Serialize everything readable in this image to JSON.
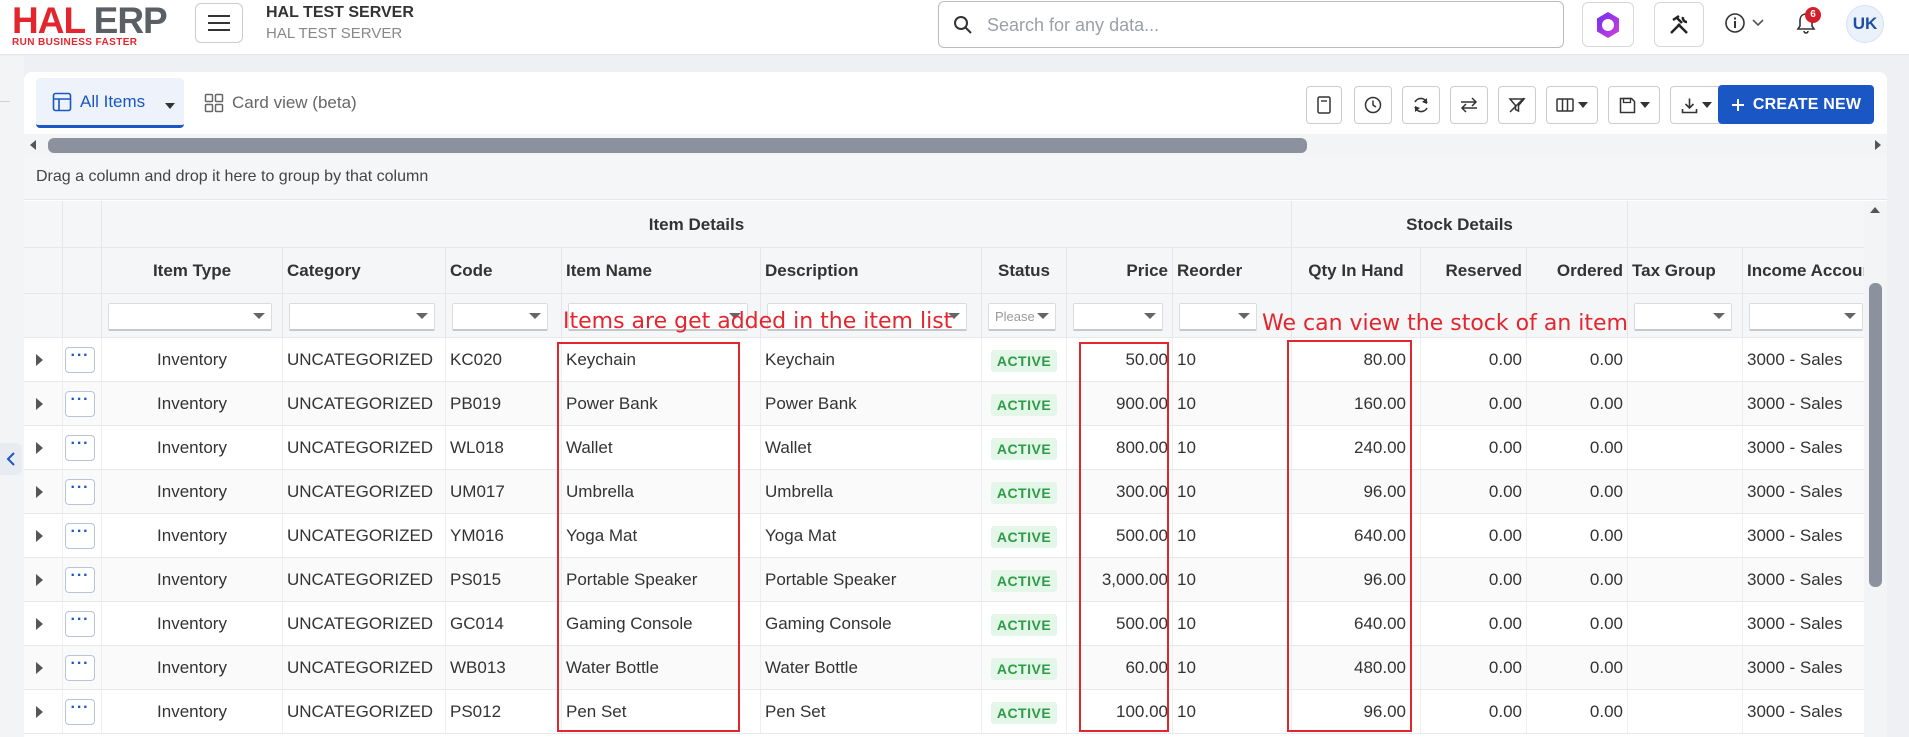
{
  "app": {
    "logo_text_1": "HAL",
    "logo_text_2": "ERP",
    "logo_tagline": "RUN BUSINESS FASTER",
    "server_title": "HAL TEST SERVER",
    "server_subtitle": "HAL TEST SERVER",
    "search_placeholder": "Search for any data...",
    "notification_count": "6",
    "avatar_initials": "UK"
  },
  "tabs": {
    "all_items": "All Items",
    "card_view": "Card view (beta)"
  },
  "toolbar": {
    "create_label": "CREATE NEW"
  },
  "group_hint": "Drag a column and drop it here to group by that column",
  "column_groups": {
    "item_details": "Item Details",
    "stock_details": "Stock Details"
  },
  "columns": {
    "item_type": "Item Type",
    "category": "Category",
    "code": "Code",
    "item_name": "Item Name",
    "description": "Description",
    "status": "Status",
    "price": "Price",
    "reorder": "Reorder",
    "qty_in_hand": "Qty In Hand",
    "reserved": "Reserved",
    "ordered": "Ordered",
    "tax_group": "Tax Group",
    "income_account": "Income Account"
  },
  "status_filter_placeholder": "Please",
  "rows": [
    {
      "type": "Inventory",
      "category": "UNCATEGORIZED",
      "code": "KC020",
      "name": "Keychain",
      "description": "Keychain",
      "status": "ACTIVE",
      "price": "50.00",
      "reorder": "10",
      "qty": "80.00",
      "reserved": "0.00",
      "ordered": "0.00",
      "tax": "",
      "income": "3000 - Sales"
    },
    {
      "type": "Inventory",
      "category": "UNCATEGORIZED",
      "code": "PB019",
      "name": "Power Bank",
      "description": "Power Bank",
      "status": "ACTIVE",
      "price": "900.00",
      "reorder": "10",
      "qty": "160.00",
      "reserved": "0.00",
      "ordered": "0.00",
      "tax": "",
      "income": "3000 - Sales"
    },
    {
      "type": "Inventory",
      "category": "UNCATEGORIZED",
      "code": "WL018",
      "name": "Wallet",
      "description": "Wallet",
      "status": "ACTIVE",
      "price": "800.00",
      "reorder": "10",
      "qty": "240.00",
      "reserved": "0.00",
      "ordered": "0.00",
      "tax": "",
      "income": "3000 - Sales"
    },
    {
      "type": "Inventory",
      "category": "UNCATEGORIZED",
      "code": "UM017",
      "name": "Umbrella",
      "description": "Umbrella",
      "status": "ACTIVE",
      "price": "300.00",
      "reorder": "10",
      "qty": "96.00",
      "reserved": "0.00",
      "ordered": "0.00",
      "tax": "",
      "income": "3000 - Sales"
    },
    {
      "type": "Inventory",
      "category": "UNCATEGORIZED",
      "code": "YM016",
      "name": "Yoga Mat",
      "description": "Yoga Mat",
      "status": "ACTIVE",
      "price": "500.00",
      "reorder": "10",
      "qty": "640.00",
      "reserved": "0.00",
      "ordered": "0.00",
      "tax": "",
      "income": "3000 - Sales"
    },
    {
      "type": "Inventory",
      "category": "UNCATEGORIZED",
      "code": "PS015",
      "name": "Portable Speaker",
      "description": "Portable Speaker",
      "status": "ACTIVE",
      "price": "3,000.00",
      "reorder": "10",
      "qty": "96.00",
      "reserved": "0.00",
      "ordered": "0.00",
      "tax": "",
      "income": "3000 - Sales"
    },
    {
      "type": "Inventory",
      "category": "UNCATEGORIZED",
      "code": "GC014",
      "name": "Gaming Console",
      "description": "Gaming Console",
      "status": "ACTIVE",
      "price": "500.00",
      "reorder": "10",
      "qty": "640.00",
      "reserved": "0.00",
      "ordered": "0.00",
      "tax": "",
      "income": "3000 - Sales"
    },
    {
      "type": "Inventory",
      "category": "UNCATEGORIZED",
      "code": "WB013",
      "name": "Water Bottle",
      "description": "Water Bottle",
      "status": "ACTIVE",
      "price": "60.00",
      "reorder": "10",
      "qty": "480.00",
      "reserved": "0.00",
      "ordered": "0.00",
      "tax": "",
      "income": "3000 - Sales"
    },
    {
      "type": "Inventory",
      "category": "UNCATEGORIZED",
      "code": "PS012",
      "name": "Pen Set",
      "description": "Pen Set",
      "status": "ACTIVE",
      "price": "100.00",
      "reorder": "10",
      "qty": "96.00",
      "reserved": "0.00",
      "ordered": "0.00",
      "tax": "",
      "income": "3000 - Sales"
    }
  ],
  "annotations": {
    "items_note": "Items are get added in the item list",
    "stock_note": "We can view the stock of an item"
  },
  "colors": {
    "brand_red": "#e3262e",
    "primary_blue": "#1a56c4",
    "active_green": "#2e9b48"
  }
}
